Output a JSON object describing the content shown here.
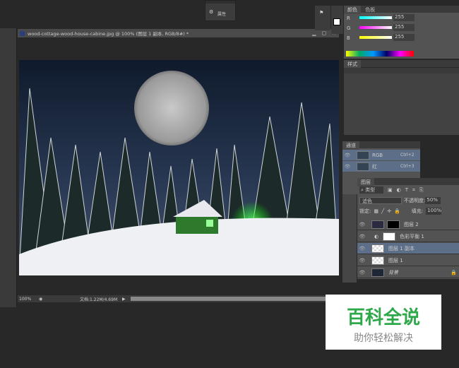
{
  "document": {
    "title": "wood-cottage-wood-house-cabine.jpg @ 100% (图层 1 副本, RGB/8#) *",
    "zoom": "100%",
    "doc_size": "文档:1.22M/4.69M"
  },
  "properties_panel": {
    "label": "属性"
  },
  "color_panel": {
    "tabs": [
      "颜色",
      "色板"
    ],
    "channels": [
      {
        "name": "R",
        "value": "255"
      },
      {
        "name": "G",
        "value": "255"
      },
      {
        "name": "B",
        "value": "255"
      }
    ],
    "styles_tab": "样式"
  },
  "channels_panel": {
    "tab": "通道",
    "rows": [
      {
        "name": "RGB",
        "shortcut": "Ctrl+2"
      },
      {
        "name": "红",
        "shortcut": "Ctrl+3"
      }
    ]
  },
  "layers_panel": {
    "tab": "图层",
    "filter": "类型",
    "blend_mode": "滤色",
    "opacity_label": "不透明度:",
    "opacity": "50%",
    "lock_label": "锁定:",
    "fill_label": "填充:",
    "fill": "100%",
    "layers": [
      {
        "name": "图层 2",
        "selected": false
      },
      {
        "name": "色彩平衡 1",
        "selected": false
      },
      {
        "name": "图层 1 副本",
        "selected": true
      },
      {
        "name": "图层 1",
        "selected": false
      },
      {
        "name": "背景",
        "selected": false
      }
    ]
  },
  "watermark": {
    "title": "百科全说",
    "subtitle": "助你轻松解决"
  }
}
